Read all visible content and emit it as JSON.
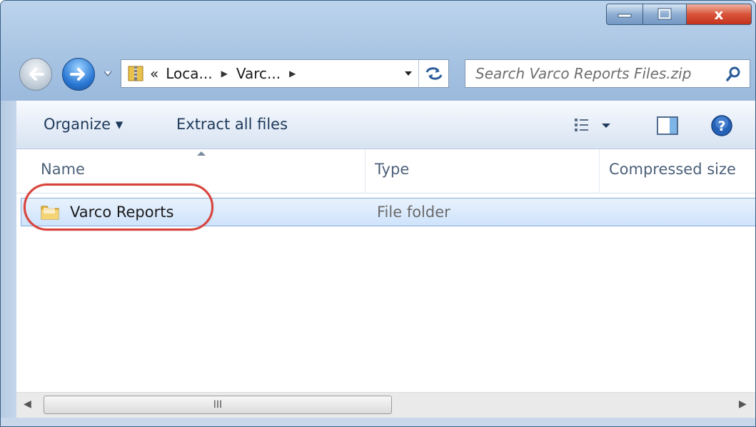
{
  "window": {
    "controls": {
      "minimize_icon": "minimize-icon",
      "maximize_icon": "maximize-icon",
      "close_label": "x"
    }
  },
  "address_bar": {
    "overflow": "«",
    "crumbs": [
      "Loca...",
      "Varc..."
    ]
  },
  "search": {
    "placeholder": "Search Varco Reports Files.zip"
  },
  "toolbar": {
    "organize_label": "Organize ▾",
    "extract_label": "Extract all files"
  },
  "columns": [
    "Name",
    "Type",
    "Compressed size"
  ],
  "rows": [
    {
      "name": "Varco Reports",
      "type": "File folder"
    }
  ],
  "scrollbar": {
    "thumb_grip": "III"
  },
  "colors": {
    "accent": "#2c7ad6",
    "selection": "#cfe3fb",
    "highlight_ring": "#d9433b"
  }
}
